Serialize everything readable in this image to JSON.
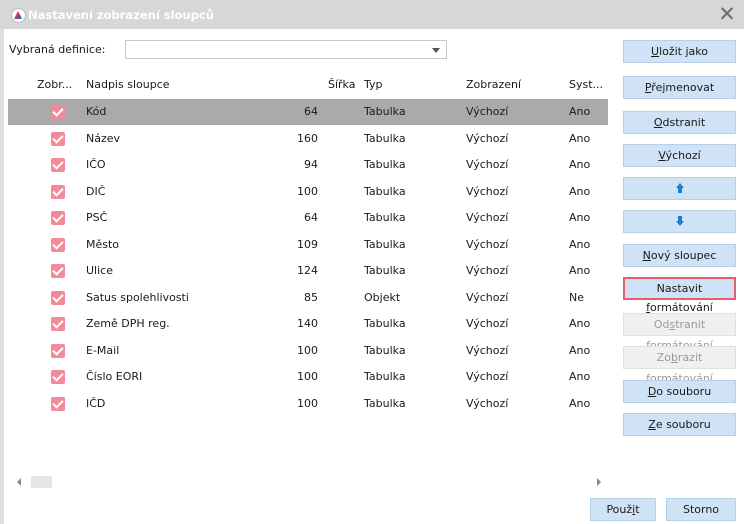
{
  "window": {
    "title": "Nastavení zobrazení sloupců"
  },
  "definition": {
    "label": "Vybraná definice:",
    "value": ""
  },
  "table": {
    "headers": {
      "show": "Zobr...",
      "caption": "Nadpis sloupce",
      "width": "Šířka",
      "type": "Typ",
      "display": "Zobrazení",
      "system": "Syst..."
    },
    "rows": [
      {
        "checked": true,
        "caption": "Kód",
        "width": "64",
        "type": "Tabulka",
        "display": "Výchozí",
        "system": "Ano"
      },
      {
        "checked": true,
        "caption": "Název",
        "width": "160",
        "type": "Tabulka",
        "display": "Výchozí",
        "system": "Ano"
      },
      {
        "checked": true,
        "caption": "IČO",
        "width": "94",
        "type": "Tabulka",
        "display": "Výchozí",
        "system": "Ano"
      },
      {
        "checked": true,
        "caption": "DIČ",
        "width": "100",
        "type": "Tabulka",
        "display": "Výchozí",
        "system": "Ano"
      },
      {
        "checked": true,
        "caption": "PSČ",
        "width": "64",
        "type": "Tabulka",
        "display": "Výchozí",
        "system": "Ano"
      },
      {
        "checked": true,
        "caption": "Město",
        "width": "109",
        "type": "Tabulka",
        "display": "Výchozí",
        "system": "Ano"
      },
      {
        "checked": true,
        "caption": "Ulice",
        "width": "124",
        "type": "Tabulka",
        "display": "Výchozí",
        "system": "Ano"
      },
      {
        "checked": true,
        "caption": "Satus spolehlivosti",
        "width": "85",
        "type": "Objekt",
        "display": "Výchozí",
        "system": "Ne"
      },
      {
        "checked": true,
        "caption": "Země DPH reg.",
        "width": "140",
        "type": "Tabulka",
        "display": "Výchozí",
        "system": "Ano"
      },
      {
        "checked": true,
        "caption": "E-Mail",
        "width": "100",
        "type": "Tabulka",
        "display": "Výchozí",
        "system": "Ano"
      },
      {
        "checked": true,
        "caption": "Číslo EORI",
        "width": "100",
        "type": "Tabulka",
        "display": "Výchozí",
        "system": "Ano"
      },
      {
        "checked": true,
        "caption": "IČD",
        "width": "100",
        "type": "Tabulka",
        "display": "Výchozí",
        "system": "Ano"
      }
    ]
  },
  "side_buttons": {
    "save_as": {
      "pre": "",
      "u": "U",
      "post": "ložit jako"
    },
    "rename": {
      "pre": "",
      "u": "P",
      "post": "řejmenovat"
    },
    "remove": {
      "pre": "",
      "u": "O",
      "post": "dstranit"
    },
    "default": {
      "pre": "",
      "u": "V",
      "post": "ýchozí"
    },
    "new_column": {
      "pre": "",
      "u": "N",
      "post": "ový sloupec"
    },
    "set_formatting": {
      "pre": "Nastavit ",
      "u": "f",
      "post": "ormátování"
    },
    "remove_formatting": {
      "pre": "Od",
      "u": "s",
      "post": "tranit formátování"
    },
    "show_formatting": {
      "pre": "Zo",
      "u": "b",
      "post": "razit formátování"
    },
    "to_file": {
      "pre": "",
      "u": "D",
      "post": "o souboru"
    },
    "from_file": {
      "pre": "",
      "u": "Z",
      "post": "e souboru"
    }
  },
  "footer": {
    "apply": {
      "pre": "Použ",
      "u": "i",
      "post": "t"
    },
    "cancel": "Storno"
  },
  "colors": {
    "checkbox": "#f28a9a",
    "selected_row": "#aaaaaa",
    "button": "#cfe2f6",
    "focus_border": "#e0606e",
    "arrow": "#1c7fd1"
  }
}
